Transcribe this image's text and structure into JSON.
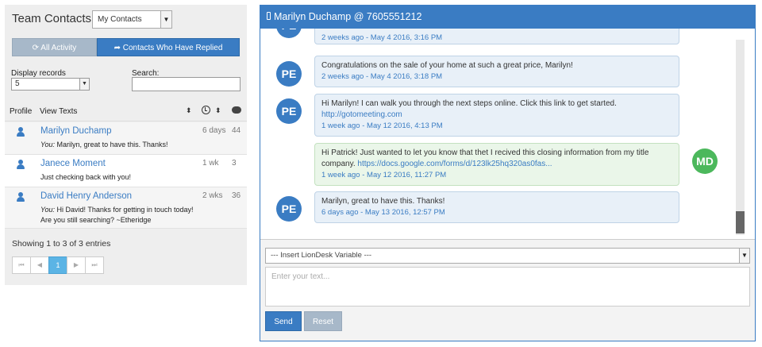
{
  "left_panel": {
    "title": "Team Contacts",
    "contacts_filter": "My Contacts",
    "tab_all_activity": "All Activity",
    "tab_replied": "Contacts Who Have Replied",
    "display_records_label": "Display records",
    "display_records_value": "5",
    "search_label": "Search:",
    "search_value": "",
    "table": {
      "header_profile": "Profile",
      "header_view_texts": "View Texts",
      "rows": [
        {
          "name": "Marilyn Duchamp",
          "prefix": "You:",
          "message": "Marilyn, great to have this. Thanks!",
          "age": "6 days",
          "count": "44"
        },
        {
          "name": "Janece Moment",
          "prefix": "",
          "message": "Just checking back with you!",
          "age": "1 wk",
          "count": "3"
        },
        {
          "name": "David Henry Anderson",
          "prefix": "You:",
          "message": "Hi David! Thanks for getting in touch today! Are you still searching? ~Etheridge",
          "age": "2 wks",
          "count": "36"
        }
      ]
    },
    "showing": "Showing 1 to 3 of 3 entries",
    "pager": {
      "first": "⏮",
      "prev": "◀",
      "current": "1",
      "next": "▶",
      "last": "⏭"
    }
  },
  "conversation": {
    "title": "Marilyn Duchamp @ 7605551212",
    "messages": [
      {
        "sender": "PE",
        "text": "",
        "link": "",
        "meta": "2 weeks ago - May 4 2016, 3:16 PM"
      },
      {
        "sender": "PE",
        "text": "Congratulations on the sale of your home at such a great price, Marilyn!",
        "link": "",
        "meta": "2 weeks ago - May 4 2016, 3:18 PM"
      },
      {
        "sender": "PE",
        "text": "Hi Marilyn! I can walk you through the next steps online. Click this link to get started.",
        "link": "http://gotomeeting.com",
        "meta": "1 week ago - May 12 2016, 4:13 PM"
      },
      {
        "sender": "MD",
        "text": "Hi Patrick! Just wanted to let you know that thet I recived this closing information from my title company.",
        "link": "https://docs.google.com/forms/d/123lk25hq320as0fas...",
        "meta": "1 week ago - May 12 2016, 11:27 PM"
      },
      {
        "sender": "PE",
        "text": "Marilyn, great to have this. Thanks!",
        "link": "",
        "meta": "6 days ago - May 13 2016, 12:57 PM"
      }
    ],
    "variable_select": "--- Insert LionDesk Variable ---",
    "text_placeholder": "Enter your text...",
    "send_label": "Send",
    "reset_label": "Reset"
  },
  "colors": {
    "accent": "#3a7cc3",
    "agent_avatar": "#3a7cc3",
    "contact_avatar": "#4cb85c",
    "disabled_button": "#a7b8c9"
  },
  "icons": [
    "refresh-icon",
    "reply-icon",
    "sort-icon",
    "clock-icon",
    "chat-icon",
    "person-icon",
    "phone-icon"
  ]
}
